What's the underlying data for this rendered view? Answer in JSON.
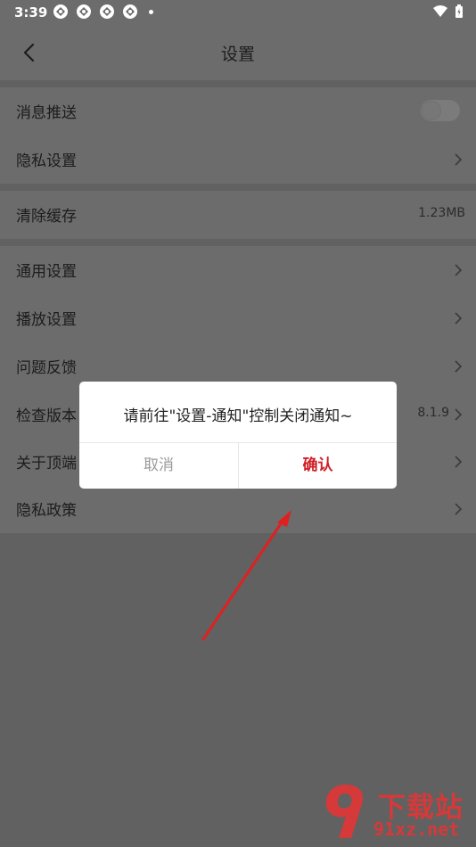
{
  "status_bar": {
    "time": "3:39"
  },
  "header": {
    "title": "设置"
  },
  "settings": {
    "push": {
      "label": "消息推送"
    },
    "privacy_settings": {
      "label": "隐私设置"
    },
    "clear_cache": {
      "label": "清除缓存",
      "value": "1.23MB"
    },
    "general": {
      "label": "通用设置"
    },
    "playback": {
      "label": "播放设置"
    },
    "feedback": {
      "label": "问题反馈"
    },
    "check_version": {
      "label": "检查版本",
      "value": "8.1.9"
    },
    "about": {
      "label": "关于顶端"
    },
    "privacy_policy": {
      "label": "隐私政策"
    }
  },
  "dialog": {
    "message": "请前往\"设置-通知\"控制关闭通知~",
    "cancel_label": "取消",
    "confirm_label": "确认"
  },
  "watermark": {
    "title": "下载站",
    "domain": "91xz.net"
  },
  "colors": {
    "overlay": "#6c6c6c",
    "confirm": "#cf1f26",
    "cancel": "#9b9b9b",
    "arrow": "#e02020"
  }
}
